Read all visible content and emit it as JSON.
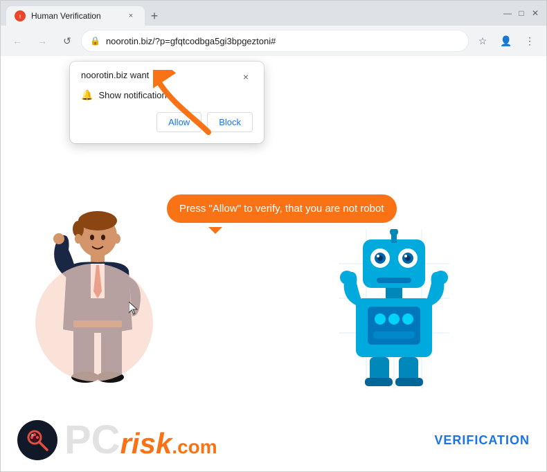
{
  "browser": {
    "tab": {
      "title": "Human Verification",
      "favicon": "HV",
      "close_label": "×"
    },
    "new_tab_label": "+",
    "window_controls": {
      "minimize": "—",
      "maximize": "□",
      "close": "✕"
    },
    "nav": {
      "back": "←",
      "forward": "→",
      "reload": "↺",
      "url": "noorotin.biz/?p=gfqtcodbga5gi3bpgeztoni#",
      "lock_symbol": "🔒",
      "bookmark": "☆",
      "account": "👤",
      "menu": "⋮"
    }
  },
  "popup": {
    "site_text": "noorotin.biz want",
    "close_label": "×",
    "permission_text": "Show notifications",
    "allow_label": "Allow",
    "block_label": "Block"
  },
  "page": {
    "speech_bubble": "Press \"Allow\" to verify, that you are not robot"
  },
  "footer": {
    "logo_pc": "PC",
    "logo_risk": "risk",
    "logo_dotcom": ".com",
    "verification": "VERIFICATION"
  }
}
